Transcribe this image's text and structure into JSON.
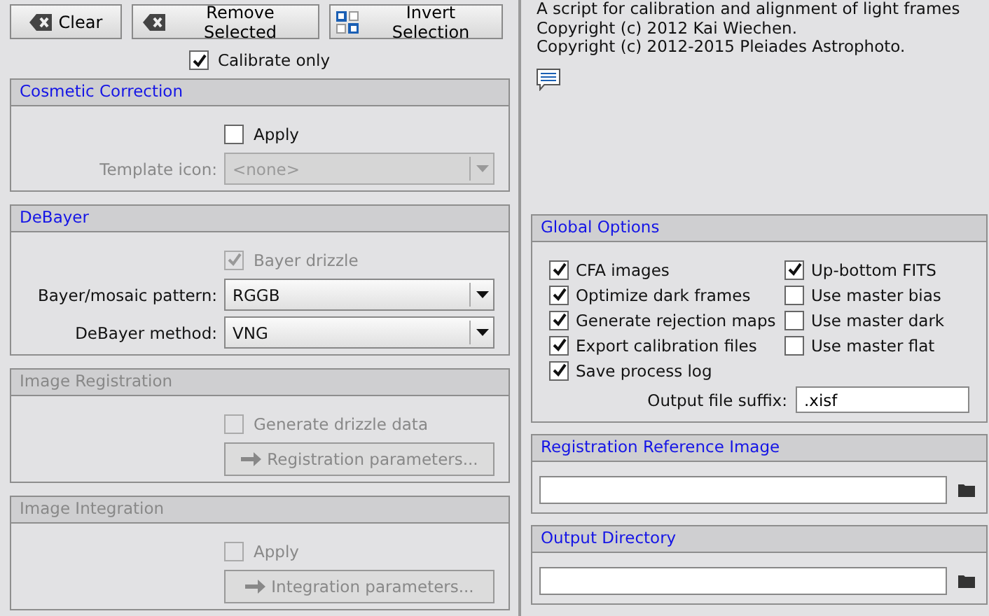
{
  "toolbar": [
    {
      "label": "Clear",
      "kind": "erase"
    },
    {
      "label": "Remove Selected",
      "kind": "erase"
    },
    {
      "label": "Invert Selection",
      "kind": "invert"
    }
  ],
  "calibrate_only": {
    "label": "Calibrate only",
    "checked": true
  },
  "left_sections": [
    {
      "title": "Cosmetic Correction",
      "enabled": true,
      "rows": [
        {
          "kind": "checkbox",
          "label": "Apply",
          "checked": false,
          "disabled": false
        },
        {
          "kind": "combo",
          "label": "Template icon:",
          "value": "<none>",
          "disabled": true
        }
      ]
    },
    {
      "title": "DeBayer",
      "enabled": true,
      "rows": [
        {
          "kind": "checkbox",
          "label": "Bayer drizzle",
          "checked": true,
          "disabled": true
        },
        {
          "kind": "combo",
          "label": "Bayer/mosaic pattern:",
          "value": "RGGB",
          "disabled": false
        },
        {
          "kind": "combo",
          "label": "DeBayer method:",
          "value": "VNG",
          "disabled": false
        }
      ]
    },
    {
      "title": "Image Registration",
      "enabled": false,
      "rows": [
        {
          "kind": "checkbox",
          "label": "Generate drizzle data",
          "checked": false,
          "disabled": true
        },
        {
          "kind": "button",
          "label": "Registration parameters...",
          "disabled": true
        }
      ]
    },
    {
      "title": "Image Integration",
      "enabled": false,
      "rows": [
        {
          "kind": "checkbox",
          "label": "Apply",
          "checked": false,
          "disabled": true
        },
        {
          "kind": "button",
          "label": "Integration parameters...",
          "disabled": true
        }
      ]
    }
  ],
  "about": [
    "A script for calibration and alignment of light frames",
    "Copyright (c) 2012 Kai Wiechen.",
    "Copyright (c) 2012-2015 Pleiades Astrophoto."
  ],
  "global_options": {
    "title": "Global Options",
    "enabled": true,
    "left": [
      {
        "label": "CFA images",
        "checked": true
      },
      {
        "label": "Optimize dark frames",
        "checked": true
      },
      {
        "label": "Generate rejection maps",
        "checked": true
      },
      {
        "label": "Export calibration files",
        "checked": true
      },
      {
        "label": "Save process log",
        "checked": true
      }
    ],
    "right": [
      {
        "label": "Up-bottom FITS",
        "checked": true
      },
      {
        "label": "Use master bias",
        "checked": false
      },
      {
        "label": "Use master dark",
        "checked": false
      },
      {
        "label": "Use master flat",
        "checked": false
      }
    ],
    "suffix": {
      "label": "Output file suffix:",
      "value": ".xisf"
    }
  },
  "path_sections": [
    {
      "title": "Registration Reference Image",
      "enabled": true
    },
    {
      "title": "Output Directory",
      "enabled": true
    }
  ]
}
